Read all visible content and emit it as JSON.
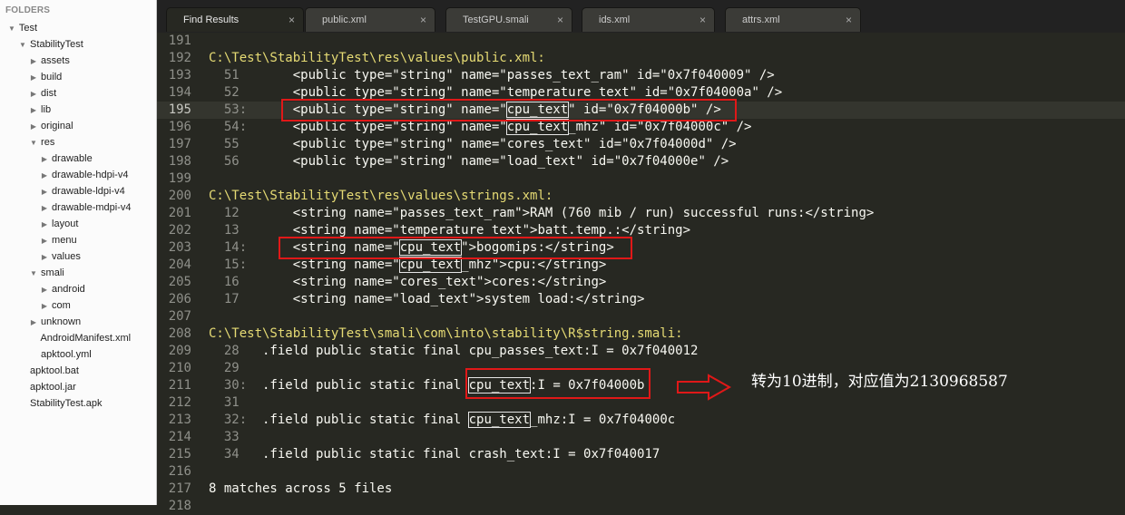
{
  "sidebar": {
    "header": "FOLDERS",
    "items": [
      {
        "label": "Test",
        "depth": 0,
        "arrow": "open"
      },
      {
        "label": "StabilityTest",
        "depth": 1,
        "arrow": "open"
      },
      {
        "label": "assets",
        "depth": 2,
        "arrow": "closed"
      },
      {
        "label": "build",
        "depth": 2,
        "arrow": "closed"
      },
      {
        "label": "dist",
        "depth": 2,
        "arrow": "closed"
      },
      {
        "label": "lib",
        "depth": 2,
        "arrow": "closed"
      },
      {
        "label": "original",
        "depth": 2,
        "arrow": "closed"
      },
      {
        "label": "res",
        "depth": 2,
        "arrow": "open"
      },
      {
        "label": "drawable",
        "depth": 3,
        "arrow": "closed"
      },
      {
        "label": "drawable-hdpi-v4",
        "depth": 3,
        "arrow": "closed"
      },
      {
        "label": "drawable-ldpi-v4",
        "depth": 3,
        "arrow": "closed"
      },
      {
        "label": "drawable-mdpi-v4",
        "depth": 3,
        "arrow": "closed"
      },
      {
        "label": "layout",
        "depth": 3,
        "arrow": "closed"
      },
      {
        "label": "menu",
        "depth": 3,
        "arrow": "closed"
      },
      {
        "label": "values",
        "depth": 3,
        "arrow": "closed"
      },
      {
        "label": "smali",
        "depth": 2,
        "arrow": "open"
      },
      {
        "label": "android",
        "depth": 3,
        "arrow": "closed"
      },
      {
        "label": "com",
        "depth": 3,
        "arrow": "closed"
      },
      {
        "label": "unknown",
        "depth": 2,
        "arrow": "closed"
      },
      {
        "label": "AndroidManifest.xml",
        "depth": 2,
        "arrow": "none"
      },
      {
        "label": "apktool.yml",
        "depth": 2,
        "arrow": "none"
      },
      {
        "label": "apktool.bat",
        "depth": 1,
        "arrow": "none"
      },
      {
        "label": "apktool.jar",
        "depth": 1,
        "arrow": "none"
      },
      {
        "label": "StabilityTest.apk",
        "depth": 1,
        "arrow": "none"
      }
    ]
  },
  "tabs": [
    {
      "label": "Find Results",
      "active": true
    },
    {
      "label": "public.xml",
      "active": false
    },
    {
      "label": "TestGPU.smali",
      "active": false
    },
    {
      "label": "ids.xml",
      "active": false
    },
    {
      "label": "attrs.xml",
      "active": false
    }
  ],
  "tab_close_glyph": "×",
  "lines": [
    {
      "n": "191",
      "t": "empty"
    },
    {
      "n": "192",
      "t": "file",
      "text": "C:\\Test\\StabilityTest\\res\\values\\public.xml:"
    },
    {
      "n": "193",
      "t": "match",
      "sub": "51",
      "sep": "  ",
      "pre": "    <public type=\"string\" name=\"passes_text_ram\" id=\"0x7f040009\" />"
    },
    {
      "n": "194",
      "t": "match",
      "sub": "52",
      "sep": "  ",
      "pre": "    <public type=\"string\" name=\"temperature_text\" id=\"0x7f04000a\" />"
    },
    {
      "n": "195",
      "t": "match",
      "cur": true,
      "sub": "53",
      "sep": ": ",
      "pre": "    <public type=\"string\" name=\"",
      "m": "cpu_text",
      "post": "\" id=\"0x7f04000b\" />"
    },
    {
      "n": "196",
      "t": "match",
      "sub": "54",
      "sep": ": ",
      "pre": "    <public type=\"string\" name=\"",
      "m": "cpu_text",
      "post": "_mhz\" id=\"0x7f04000c\" />"
    },
    {
      "n": "197",
      "t": "match",
      "sub": "55",
      "sep": "  ",
      "pre": "    <public type=\"string\" name=\"cores_text\" id=\"0x7f04000d\" />"
    },
    {
      "n": "198",
      "t": "match",
      "sub": "56",
      "sep": "  ",
      "pre": "    <public type=\"string\" name=\"load_text\" id=\"0x7f04000e\" />"
    },
    {
      "n": "199",
      "t": "empty"
    },
    {
      "n": "200",
      "t": "file",
      "text": "C:\\Test\\StabilityTest\\res\\values\\strings.xml:"
    },
    {
      "n": "201",
      "t": "match",
      "sub": "12",
      "sep": "  ",
      "pre": "    <string name=\"passes_text_ram\">RAM (760 mib / run) successful runs:</string>"
    },
    {
      "n": "202",
      "t": "match",
      "sub": "13",
      "sep": "  ",
      "pre": "    <string name=\"temperature_text\">batt.temp.:</string>"
    },
    {
      "n": "203",
      "t": "match",
      "sub": "14",
      "sep": ": ",
      "pre": "    <string name=\"",
      "m": "cpu_text",
      "post": "\">bogomips:</string>"
    },
    {
      "n": "204",
      "t": "match",
      "sub": "15",
      "sep": ": ",
      "pre": "    <string name=\"",
      "m": "cpu_text",
      "post": "_mhz\">cpu:</string>"
    },
    {
      "n": "205",
      "t": "match",
      "sub": "16",
      "sep": "  ",
      "pre": "    <string name=\"cores_text\">cores:</string>"
    },
    {
      "n": "206",
      "t": "match",
      "sub": "17",
      "sep": "  ",
      "pre": "    <string name=\"load_text\">system load:</string>"
    },
    {
      "n": "207",
      "t": "empty"
    },
    {
      "n": "208",
      "t": "file",
      "text": "C:\\Test\\StabilityTest\\smali\\com\\into\\stability\\R$string.smali:"
    },
    {
      "n": "209",
      "t": "match",
      "sub": "28",
      "sep": "  ",
      "pre": ".field public static final cpu_passes_text:I = 0x7f040012"
    },
    {
      "n": "210",
      "t": "match",
      "sub": "29",
      "sep": "",
      "pre": ""
    },
    {
      "n": "211",
      "t": "match",
      "sub": "30",
      "sep": ": ",
      "pre": ".field public static final ",
      "m": "cpu_text",
      "post": ":I = 0x7f04000b"
    },
    {
      "n": "212",
      "t": "match",
      "sub": "31",
      "sep": "",
      "pre": ""
    },
    {
      "n": "213",
      "t": "match",
      "sub": "32",
      "sep": ": ",
      "pre": ".field public static final ",
      "m": "cpu_text",
      "post": "_mhz:I = 0x7f04000c"
    },
    {
      "n": "214",
      "t": "match",
      "sub": "33",
      "sep": "",
      "pre": ""
    },
    {
      "n": "215",
      "t": "match",
      "sub": "34",
      "sep": "  ",
      "pre": ".field public static final crash_text:I = 0x7f040017"
    },
    {
      "n": "216",
      "t": "empty"
    },
    {
      "n": "217",
      "t": "summary",
      "text": "8 matches across 5 files"
    },
    {
      "n": "218",
      "t": "empty"
    }
  ],
  "annotation": {
    "text": "转为10进制，对应值为2130968587",
    "color": "#e01818"
  },
  "colors": {
    "background": "#272822",
    "filename": "#e6db74",
    "text": "#f8f8f2",
    "gutter": "#8f908a",
    "highlight_box": "#e01818"
  },
  "icons": {
    "tree_open": "triangle-down-icon",
    "tree_closed": "triangle-right-icon",
    "tab_close": "close-icon",
    "annotation_arrow": "arrow-right-icon"
  }
}
